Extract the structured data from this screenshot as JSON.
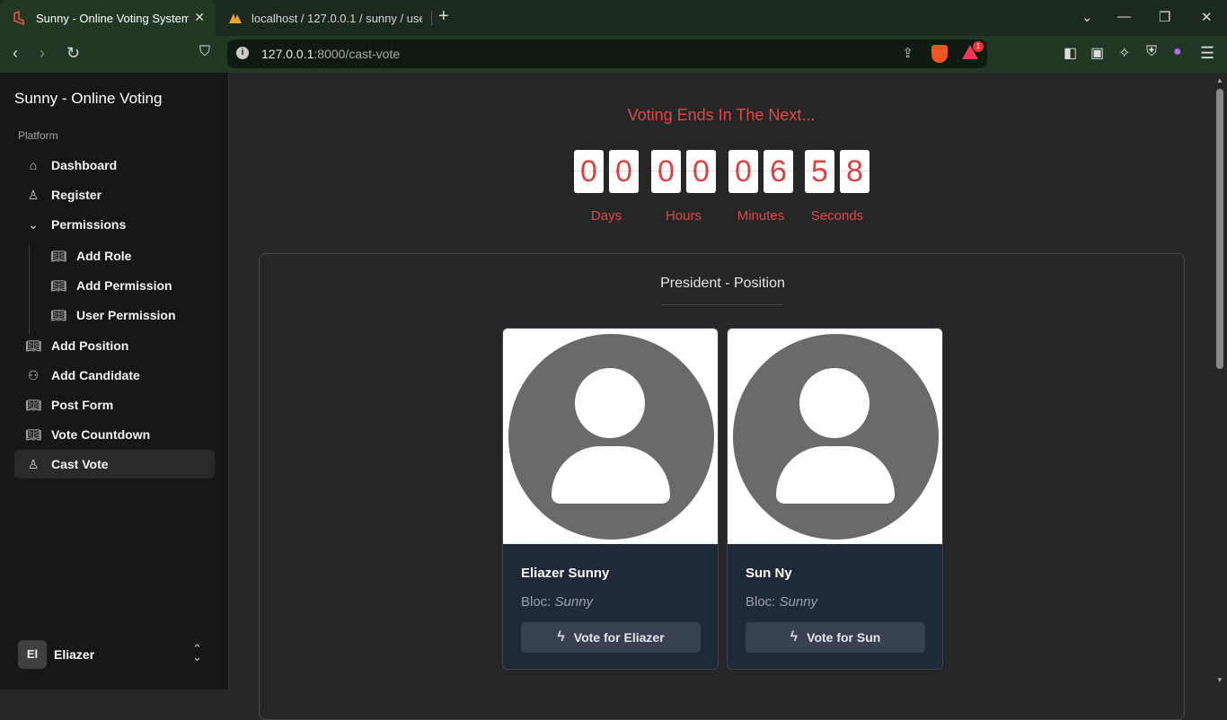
{
  "browser": {
    "tabs": [
      {
        "title": "Sunny - Online Voting System",
        "active": true
      },
      {
        "title": "localhost / 127.0.0.1 / sunny / users",
        "active": false
      }
    ],
    "url_host": "127.0.0.1",
    "url_rest": ":8000/cast-vote",
    "brave_badge": "1"
  },
  "sidebar": {
    "brand": "Sunny - Online Voting",
    "section_label": "Platform",
    "items": [
      {
        "label": "Dashboard",
        "icon": "home-icon"
      },
      {
        "label": "Register",
        "icon": "user-icon"
      },
      {
        "label": "Permissions",
        "icon": "chevron-down-icon"
      },
      {
        "label": "Add Role",
        "icon": "book-icon"
      },
      {
        "label": "Add Permission",
        "icon": "book-icon"
      },
      {
        "label": "User Permission",
        "icon": "book-icon"
      },
      {
        "label": "Add Position",
        "icon": "book-icon"
      },
      {
        "label": "Add Candidate",
        "icon": "users-icon"
      },
      {
        "label": "Post Form",
        "icon": "book-icon"
      },
      {
        "label": "Vote Countdown",
        "icon": "book-icon"
      },
      {
        "label": "Cast Vote",
        "icon": "user-icon"
      }
    ],
    "user": {
      "initials": "El",
      "name": "Eliazer"
    }
  },
  "countdown": {
    "title": "Voting Ends In The Next...",
    "groups": [
      {
        "digits": [
          "0",
          "0"
        ],
        "label": "Days"
      },
      {
        "digits": [
          "0",
          "0"
        ],
        "label": "Hours"
      },
      {
        "digits": [
          "0",
          "6"
        ],
        "label": "Minutes"
      },
      {
        "digits": [
          "5",
          "8"
        ],
        "label": "Seconds"
      }
    ],
    "color": "#e04848"
  },
  "position": {
    "title": "President - Position",
    "candidates": [
      {
        "name": "Eliazer Sunny",
        "bloc_label": "Bloc:",
        "bloc": "Sunny",
        "vote_label": "Vote for Eliazer"
      },
      {
        "name": "Sun Ny",
        "bloc_label": "Bloc:",
        "bloc": "Sunny",
        "vote_label": "Vote for Sun"
      }
    ]
  }
}
